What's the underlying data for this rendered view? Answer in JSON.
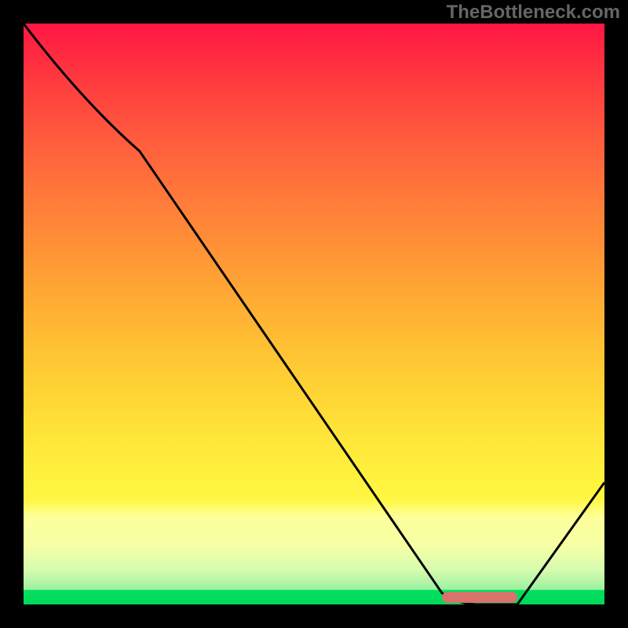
{
  "watermark": "TheBottleneck.com",
  "chart_data": {
    "type": "line",
    "title": "",
    "xlabel": "",
    "ylabel": "",
    "xlim": [
      0,
      100
    ],
    "ylim": [
      0,
      100
    ],
    "series": [
      {
        "name": "bottleneck-curve",
        "x": [
          0,
          20,
          72,
          78,
          85,
          100
        ],
        "y": [
          100,
          78,
          2,
          0,
          0,
          21
        ]
      }
    ],
    "marker": {
      "x_start": 72,
      "x_end": 85,
      "y": 0.5
    },
    "gradient_stops": [
      {
        "pct": 0,
        "color": "#ff1744"
      },
      {
        "pct": 50,
        "color": "#ffcc33"
      },
      {
        "pct": 85,
        "color": "#ffff5a"
      },
      {
        "pct": 97,
        "color": "#9af0a0"
      },
      {
        "pct": 100,
        "color": "#00d858"
      }
    ]
  }
}
